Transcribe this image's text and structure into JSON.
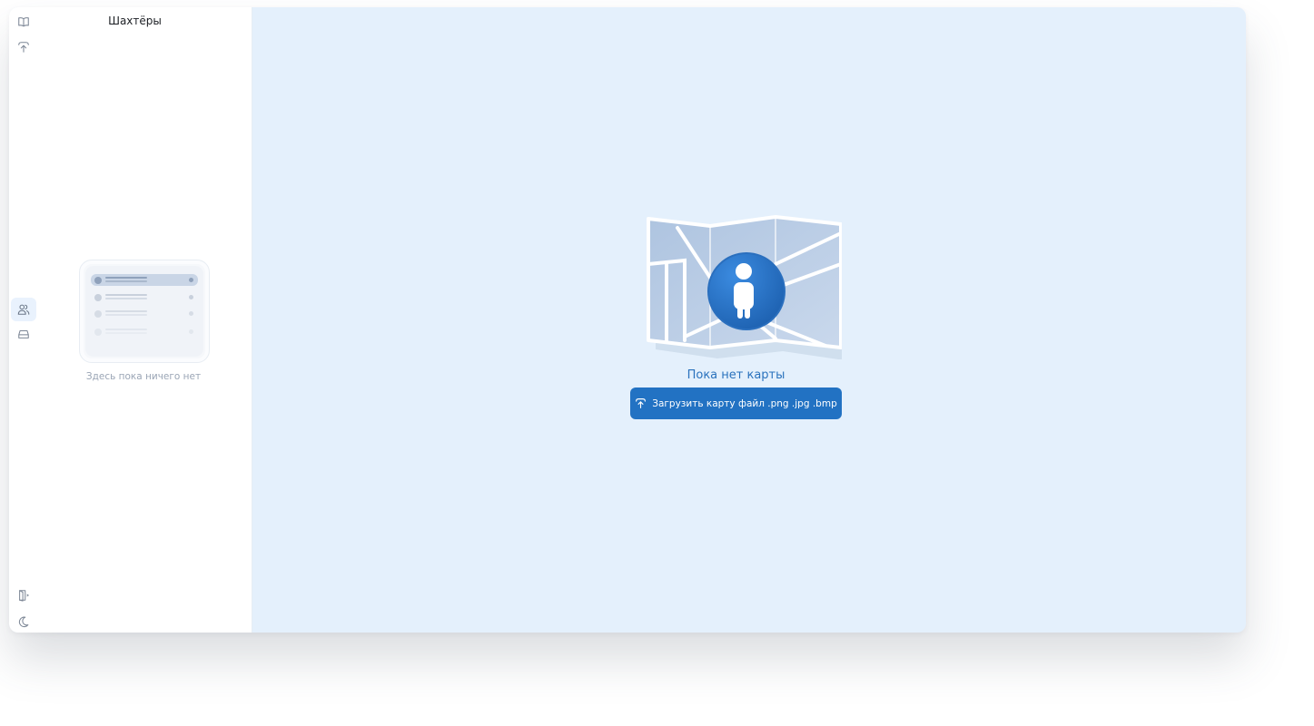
{
  "sidebar": {
    "title": "Шахтёры",
    "empty_text": "Здесь пока ничего нет",
    "icons": [
      "book-icon",
      "upload-icon",
      "users-icon",
      "drive-icon",
      "logout-icon",
      "moon-icon"
    ]
  },
  "main": {
    "empty_title": "Пока нет карты",
    "upload_button_label": "Загрузить карту файл .png .jpg .bmp"
  },
  "colors": {
    "accent": "#2272c3",
    "main_bg": "#e4f0fc",
    "title_text": "#2a72bd",
    "muted_text": "#9aa5b5"
  }
}
